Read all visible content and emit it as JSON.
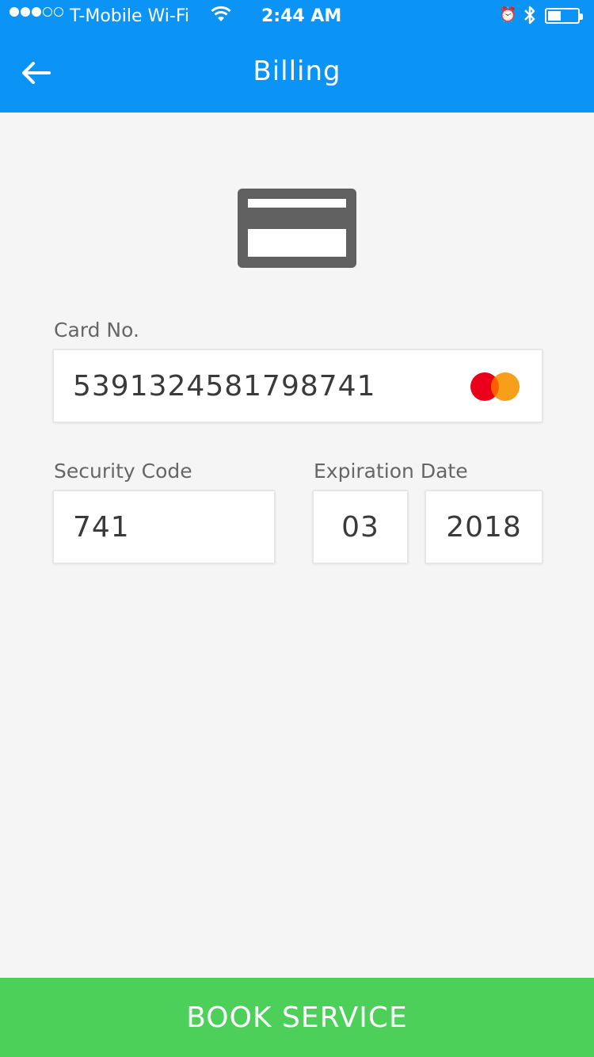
{
  "status_bar": {
    "carrier": "T-Mobile Wi-Fi",
    "time": "2:44 AM",
    "signal_bars_filled": 3,
    "signal_bars_total": 5,
    "battery_level": 0.4
  },
  "header": {
    "title": "Billing",
    "back_icon": "arrow-left-icon"
  },
  "form": {
    "card_number_label": "Card No.",
    "card_number_value": "5391324581798741",
    "card_brand_logo": "MasterCard",
    "security_code_label": "Security Code",
    "security_code_value": "741",
    "expiration_label": "Expiration Date",
    "expiration_month": "03",
    "expiration_year": "2018"
  },
  "footer": {
    "book_label": "BOOK SERVICE"
  },
  "colors": {
    "header_bg": "#0b93f6",
    "book_button_bg": "#4cd05a",
    "page_bg": "#f5f5f5",
    "card_icon": "#606060"
  }
}
